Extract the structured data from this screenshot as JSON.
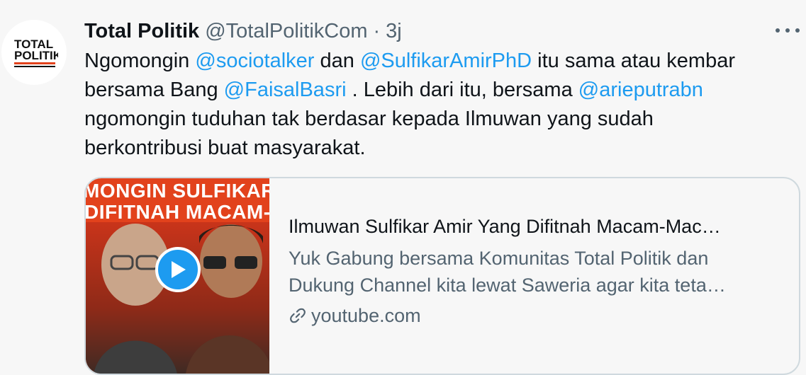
{
  "account": {
    "display_name": "Total Politik",
    "handle": "@TotalPolitikCom",
    "separator": "·",
    "time": "3j",
    "logo_text_top": "TOTAL",
    "logo_text_bottom": "POLITIK"
  },
  "tweet": {
    "line1_a": "Ngomongin ",
    "mention1": "@sociotalker",
    "line1_b": " dan ",
    "mention2": "@SulfikarAmirPhD",
    "line1_c": " itu sama atau kembar",
    "line2_a": "bersama Bang ",
    "mention3": "@FaisalBasri",
    "line2_b": " . Lebih dari itu, bersama ",
    "mention4": "@arieputrabn",
    "line3": "ngomongin tuduhan tak berdasar kepada Ilmuwan yang sudah",
    "line4": "berkontribusi buat masyarakat."
  },
  "card": {
    "thumb_line1": "MONGIN SULFIKAR A",
    "thumb_line2": "DIFITNAH MACAM-MA",
    "title": "Ilmuwan Sulfikar Amir Yang Difitnah Macam-Mac…",
    "desc_line1": "Yuk Gabung bersama Komunitas Total Politik dan",
    "desc_line2": "Dukung Channel kita lewat Saweria agar kita teta…",
    "domain": "youtube.com"
  },
  "colors": {
    "accent": "#1d9bf0",
    "secondary_text": "#536471",
    "thumb_bg": "#e2421c"
  },
  "icons": {
    "more": "more-icon",
    "play": "play-icon",
    "link": "link-icon"
  }
}
